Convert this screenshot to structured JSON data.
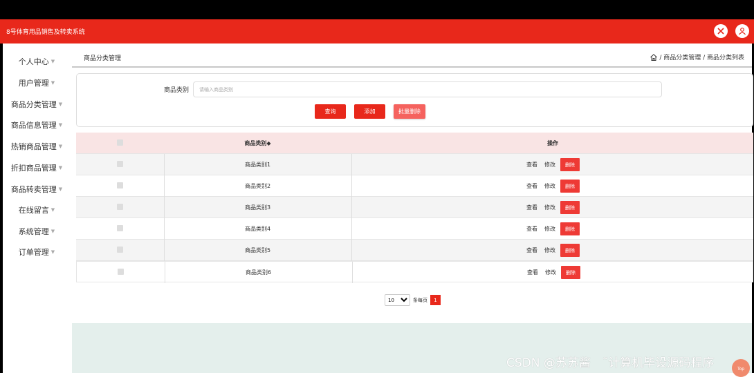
{
  "app": {
    "title": "8号体育用品销售及转卖系统"
  },
  "sidebar": {
    "items": [
      {
        "label": "个人中心"
      },
      {
        "label": "用户管理"
      },
      {
        "label": "商品分类管理"
      },
      {
        "label": "商品信息管理"
      },
      {
        "label": "热销商品管理"
      },
      {
        "label": "折扣商品管理"
      },
      {
        "label": "商品转卖管理"
      },
      {
        "label": "在线留言"
      },
      {
        "label": "系统管理"
      },
      {
        "label": "订单管理"
      }
    ],
    "caret": "▼"
  },
  "page": {
    "title": "商品分类管理",
    "breadcrumb": "/ 商品分类管理 / 商品分类列表"
  },
  "search": {
    "label": "商品类别",
    "placeholder": "请输入商品类别",
    "query_label": "查询",
    "add_label": "添加",
    "batch_delete_label": "批量删除"
  },
  "table": {
    "headers": {
      "category": "商品类别◆",
      "actions": "操作"
    },
    "rows": [
      {
        "category": "商品类别1"
      },
      {
        "category": "商品类别2"
      },
      {
        "category": "商品类别3"
      },
      {
        "category": "商品类别4"
      },
      {
        "category": "商品类别5"
      },
      {
        "category": "商品类别6"
      }
    ],
    "actions": {
      "view": "查看",
      "edit": "修改",
      "delete": "删除"
    }
  },
  "pagination": {
    "page_size": "10",
    "page_size_label": "条每页",
    "current_page": "1"
  },
  "watermark": "CSDN @苏苏酱　˜计算机毕设源码程序",
  "to_top": "Top",
  "colors": {
    "primary": "#e8281b",
    "delete": "#ee3a35",
    "batch": "#f5625e",
    "footer": "#e4efec"
  }
}
